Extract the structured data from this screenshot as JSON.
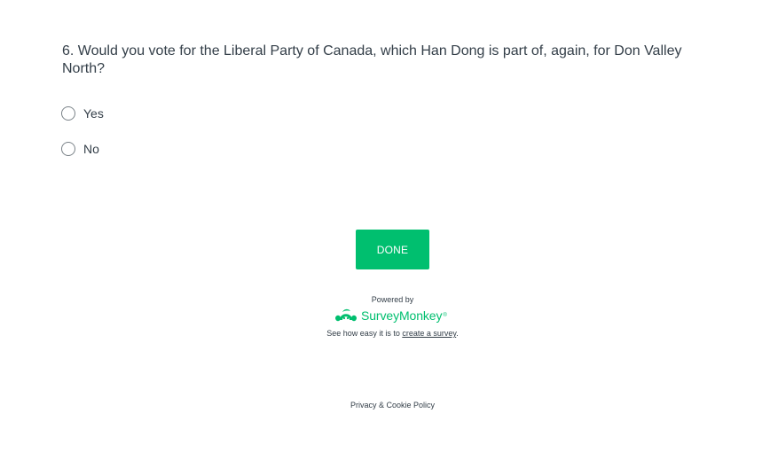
{
  "question": {
    "text": "6. Would you vote for the Liberal Party of Canada, which Han Dong is part of, again, for Don Valley North?",
    "options": [
      {
        "label": "Yes",
        "selected": false
      },
      {
        "label": "No",
        "selected": false
      }
    ]
  },
  "done_button": {
    "label": "DONE"
  },
  "branding": {
    "powered_by": "Powered by",
    "brand_name": "SurveyMonkey",
    "trademark": "®",
    "tagline_prefix": "See how easy it is to ",
    "tagline_link": "create a survey",
    "tagline_suffix": ".",
    "logo_icon": "surveymonkey-logo-icon"
  },
  "footer": {
    "policy_link": "Privacy & Cookie Policy"
  },
  "colors": {
    "accent": "#00bf6f",
    "text": "#333e48",
    "radio_border": "#7a8288"
  }
}
